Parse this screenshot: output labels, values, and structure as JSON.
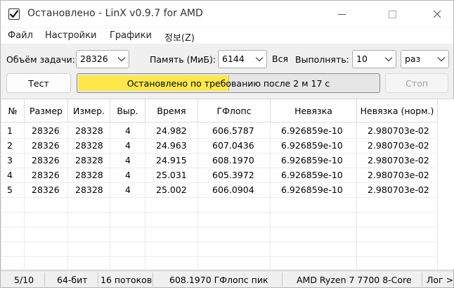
{
  "window": {
    "title": "Остановлено - LinX v0.9.7 for AMD"
  },
  "menu": [
    "Файл",
    "Настройки",
    "Графики",
    "정보(Z)"
  ],
  "params": {
    "problem_size_label": "Объём задачи:",
    "problem_size_value": "28326",
    "memory_label": "Память (МиБ):",
    "memory_value": "6144",
    "all_label": "Вся",
    "run_label": "Выполнять:",
    "run_value": "10",
    "run_unit_value": "раз"
  },
  "controls": {
    "test_button": "Тест",
    "stop_button": "Стоп",
    "status_text": "Остановлено по требованию после 2 м 17 с",
    "progress_fraction": 0.5
  },
  "table": {
    "headers": [
      "№",
      "Размер",
      "Измер.",
      "Выр.",
      "Время",
      "ГФлопс",
      "Невязка",
      "Невязка (норм.)"
    ],
    "rows": [
      [
        "1",
        "28326",
        "28328",
        "4",
        "24.982",
        "606.5787",
        "6.926859e-10",
        "2.980703e-02"
      ],
      [
        "2",
        "28326",
        "28328",
        "4",
        "24.963",
        "607.0436",
        "6.926859e-10",
        "2.980703e-02"
      ],
      [
        "3",
        "28326",
        "28328",
        "4",
        "24.915",
        "608.1970",
        "6.926859e-10",
        "2.980703e-02"
      ],
      [
        "4",
        "28326",
        "28328",
        "4",
        "25.031",
        "605.3972",
        "6.926859e-10",
        "2.980703e-02"
      ],
      [
        "5",
        "28326",
        "28328",
        "4",
        "25.002",
        "606.0904",
        "6.926859e-10",
        "2.980703e-02"
      ]
    ]
  },
  "status": {
    "progress": "5/10",
    "bits": "64-бит",
    "threads": "16 потоков",
    "peak": "608.1970 ГФлопс пик",
    "cpu": "AMD Ryzen 7 7700 8-Core",
    "log": "Лог >"
  },
  "colors": {
    "progress_fill": "#ffe84a",
    "background": "#f0f0f0"
  }
}
